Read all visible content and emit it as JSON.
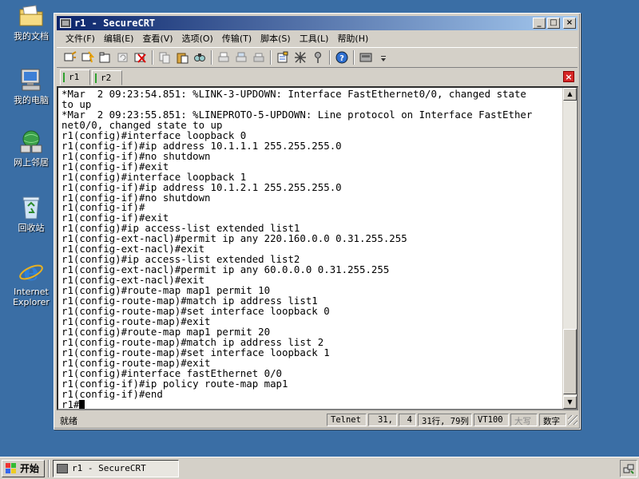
{
  "desktop": {
    "icons": [
      {
        "label": "我的文档",
        "icon": "my-documents-icon"
      },
      {
        "label": "我的电脑",
        "icon": "my-computer-icon"
      },
      {
        "label": "网上邻居",
        "icon": "network-places-icon"
      },
      {
        "label": "回收站",
        "icon": "recycle-bin-icon"
      },
      {
        "label": "Internet Explorer",
        "icon": "internet-explorer-icon"
      }
    ]
  },
  "window": {
    "title": "r1 - SecureCRT",
    "buttons": {
      "minimize": "_",
      "maximize": "□",
      "close": "×"
    }
  },
  "menubar": {
    "items": [
      "文件(F)",
      "编辑(E)",
      "查看(V)",
      "选项(O)",
      "传输(T)",
      "脚本(S)",
      "工具(L)",
      "帮助(H)"
    ]
  },
  "toolbar": {
    "icons": [
      "connect-icon",
      "quick-connect-icon",
      "connect-tab-icon",
      "reconnect-icon",
      "disconnect-icon",
      "copy-icon",
      "paste-icon",
      "find-icon",
      "print-icon",
      "print-selection-icon",
      "print-setup-icon",
      "session-options-icon",
      "global-options-icon",
      "keymap-icon",
      "help-icon",
      "sftp-icon",
      "more-icon"
    ]
  },
  "tabs": [
    {
      "label": "r1",
      "active": true
    },
    {
      "label": "r2",
      "active": false
    }
  ],
  "terminal": {
    "lines": [
      "*Mar  2 09:23:54.851: %LINK-3-UPDOWN: Interface FastEthernet0/0, changed state",
      "to up",
      "*Mar  2 09:23:55.851: %LINEPROTO-5-UPDOWN: Line protocol on Interface FastEther",
      "net0/0, changed state to up",
      "r1(config)#interface loopback 0",
      "r1(config-if)#ip address 10.1.1.1 255.255.255.0",
      "r1(config-if)#no shutdown",
      "r1(config-if)#exit",
      "r1(config)#interface loopback 1",
      "r1(config-if)#ip address 10.1.2.1 255.255.255.0",
      "r1(config-if)#no shutdown",
      "r1(config-if)#",
      "r1(config-if)#exit",
      "r1(config)#ip access-list extended list1",
      "r1(config-ext-nacl)#permit ip any 220.160.0.0 0.31.255.255",
      "r1(config-ext-nacl)#exit",
      "r1(config)#ip access-list extended list2",
      "r1(config-ext-nacl)#permit ip any 60.0.0.0 0.31.255.255",
      "r1(config-ext-nacl)#exit",
      "r1(config)#route-map map1 permit 10",
      "r1(config-route-map)#match ip address list1",
      "r1(config-route-map)#set interface loopback 0",
      "r1(config-route-map)#exit",
      "r1(config)#route-map map1 permit 20",
      "r1(config-route-map)#match ip address list 2",
      "r1(config-route-map)#set interface loopback 1",
      "r1(config-route-map)#exit",
      "r1(config)#interface fastEthernet 0/0",
      "r1(config-if)#ip policy route-map map1",
      "r1(config-if)#end"
    ],
    "prompt": "r1#"
  },
  "statusbar": {
    "ready": "就绪",
    "protocol": "Telnet",
    "row": "31,",
    "col": "4",
    "size": "31行, 79列",
    "emulation": "VT100",
    "caps": "大写",
    "num": "数字"
  },
  "taskbar": {
    "start": "开始",
    "task_label": "r1 - SecureCRT"
  },
  "colors": {
    "desktop": "#3a6ea5",
    "titlebar_start": "#0a246a",
    "titlebar_end": "#a6caf0",
    "tab_mark": "#2ea02e",
    "tab_close": "#d62626"
  }
}
